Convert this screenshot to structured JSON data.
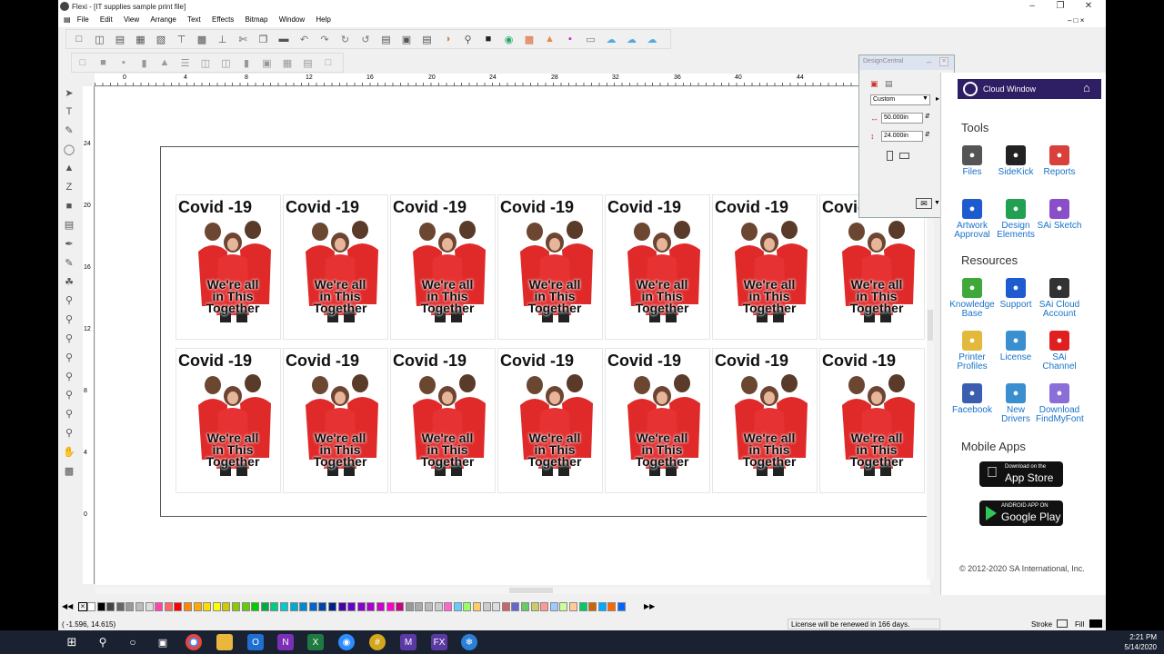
{
  "window": {
    "title": "Flexi - [IT supplies sample print file]",
    "minimize_icon": "minimize-icon",
    "restore_icon": "restore-icon",
    "close_icon": "close-icon"
  },
  "menu": [
    "File",
    "Edit",
    "View",
    "Arrange",
    "Text",
    "Effects",
    "Bitmap",
    "Window",
    "Help"
  ],
  "ruler_top_ticks": [
    "0",
    "4",
    "8",
    "12",
    "16",
    "20",
    "24",
    "28",
    "32",
    "36",
    "40",
    "44"
  ],
  "ruler_left_ticks": [
    "24",
    "20",
    "16",
    "12",
    "8",
    "4",
    "0"
  ],
  "card": {
    "headline": "Covid -19",
    "line1": "We're all",
    "line2": "in This",
    "line3": "Together"
  },
  "design_central": {
    "title": "DesignCentral",
    "preset": "Custom",
    "width": "50.000in",
    "height": "24.000in"
  },
  "cloud_window": {
    "title": "Cloud Window",
    "tools_heading": "Tools",
    "tools": [
      {
        "label": "Files",
        "icon": "files-icon",
        "color": "#555555"
      },
      {
        "label": "SideKick",
        "icon": "sidekick-icon",
        "color": "#222222"
      },
      {
        "label": "Reports",
        "icon": "reports-icon",
        "color": "#d9403b"
      },
      {
        "label": "Artwork Approval",
        "icon": "artwork-approval-icon",
        "color": "#1e5bd0"
      },
      {
        "label": "Design Elements",
        "icon": "design-elements-icon",
        "color": "#20a050"
      },
      {
        "label": "SAi Sketch",
        "icon": "sketch-icon",
        "color": "#8a4fc8"
      }
    ],
    "resources_heading": "Resources",
    "resources": [
      {
        "label": "Knowledge Base",
        "icon": "knowledge-base-icon",
        "color": "#3fa83a"
      },
      {
        "label": "Support",
        "icon": "support-icon",
        "color": "#1e5bd0"
      },
      {
        "label": "SAi Cloud Account",
        "icon": "cloud-account-icon",
        "color": "#333333"
      },
      {
        "label": "Printer Profiles",
        "icon": "printer-profiles-icon",
        "color": "#e2b93b"
      },
      {
        "label": "License",
        "icon": "license-icon",
        "color": "#3a8fd0"
      },
      {
        "label": "SAi Channel",
        "icon": "youtube-icon",
        "color": "#e02020"
      },
      {
        "label": "Facebook",
        "icon": "facebook-icon",
        "color": "#3b5fb0"
      },
      {
        "label": "New Drivers",
        "icon": "new-drivers-icon",
        "color": "#3a8fd0"
      },
      {
        "label": "Download FindMyFont",
        "icon": "findmyfont-icon",
        "color": "#8a6fd8"
      }
    ],
    "mobile_heading": "Mobile Apps",
    "app_store_small": "Download on the",
    "app_store": "App Store",
    "google_play_small": "ANDROID APP ON",
    "google_play": "Google Play",
    "copyright": "© 2012-2020 SA International, Inc."
  },
  "status": {
    "coords": "( -1.596,  14.615)",
    "license": "License will be renewed in 166 days.",
    "stroke": "Stroke",
    "fill": "Fill"
  },
  "taskbar": {
    "time": "2:21 PM",
    "date": "5/14/2020"
  },
  "colors": {
    "accent": "#2e1e64",
    "shirt": "#e02a2a"
  }
}
